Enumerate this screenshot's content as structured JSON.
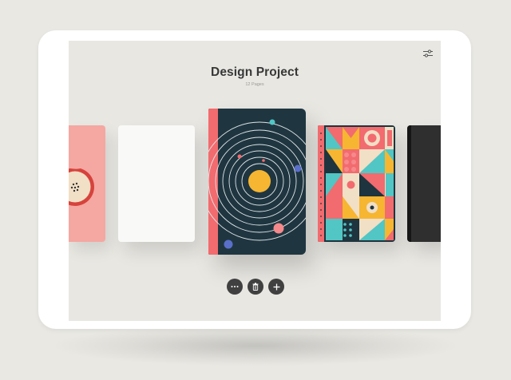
{
  "header": {
    "title": "Design Project",
    "subtitle": "12 Pages"
  },
  "icons": {
    "settings": "sliders-icon",
    "more": "ellipsis-icon",
    "delete": "trash-icon",
    "add": "plus-icon"
  },
  "notebooks": [
    {
      "name": "pink-fruit-notebook",
      "color": "#f5a7a2"
    },
    {
      "name": "white-notebook",
      "color": "#f9f9f7"
    },
    {
      "name": "space-orbit-notebook",
      "color": "#1f3641",
      "spine": "#f26b6e"
    },
    {
      "name": "geometric-pattern-notebook",
      "color": "#1e343e",
      "spine": "#f26b6e"
    },
    {
      "name": "black-notebook",
      "color": "#2f2f2f"
    }
  ],
  "colors": {
    "background": "#e9e8e3",
    "screen": "#e8e7e2",
    "button": "#404040",
    "accent_coral": "#f26b6e",
    "accent_yellow": "#f6b631",
    "accent_teal": "#51c6c4"
  }
}
